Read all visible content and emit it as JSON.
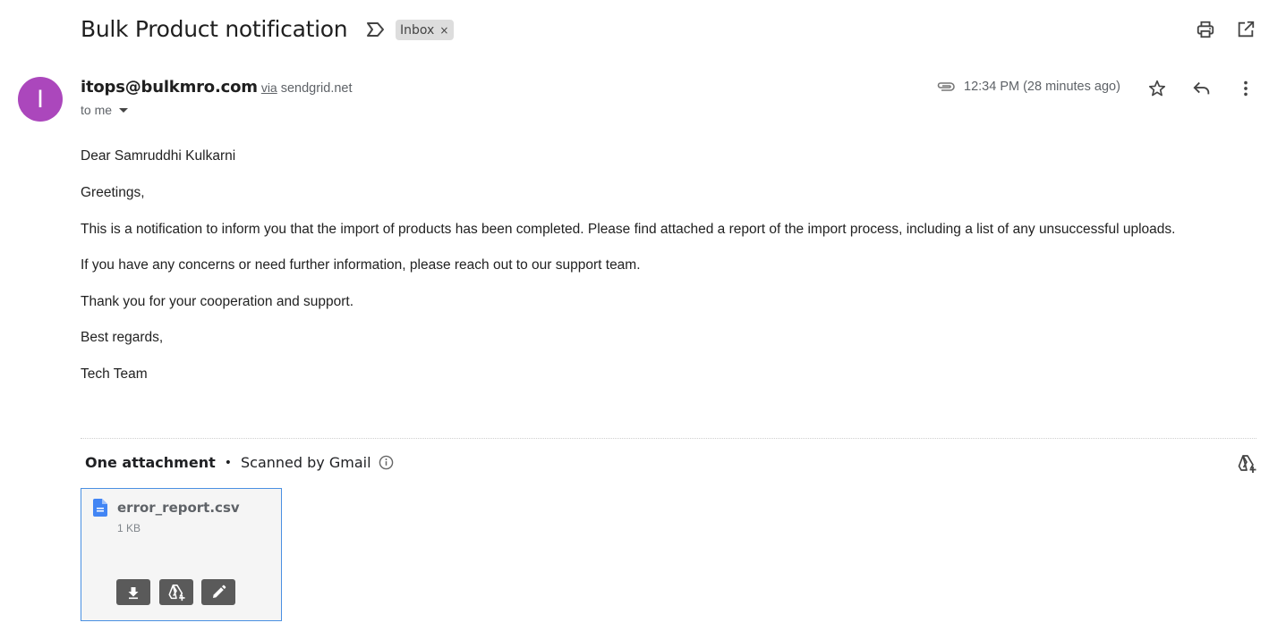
{
  "email": {
    "subject": "Bulk Product notification",
    "label_chip": "Inbox",
    "label_chip_close": "×",
    "sender_email": "itops@bulkmro.com",
    "via_word": "via",
    "via_domain": "sendgrid.net",
    "recipient": "to me",
    "avatar_letter": "I",
    "avatar_color": "#ab47bc",
    "timestamp": "12:34 PM (28 minutes ago)",
    "body": [
      "Dear Samruddhi Kulkarni",
      "Greetings,",
      "This is a notification to inform you that the import of products has been completed. Please find attached a report of the import process, including a list of any unsuccessful uploads.",
      "If you have any concerns or need further information, please reach out to our support team.",
      "Thank you for your cooperation and support.",
      "Best regards,",
      "Tech Team"
    ]
  },
  "attachments": {
    "count_label": "One attachment",
    "separator": "•",
    "scan_label": "Scanned by Gmail",
    "items": [
      {
        "file_name": "error_report.csv",
        "size": "1 KB",
        "icon": "doc-icon"
      }
    ]
  },
  "icons": {
    "header": [
      "important-marker-icon",
      "print-icon",
      "open-in-new-window-icon"
    ],
    "sender_row": [
      "attachment-clip-icon",
      "star-icon",
      "reply-icon",
      "more-vert-icon"
    ],
    "attachments": [
      "info-icon",
      "add-to-drive-icon",
      "download-icon",
      "edit-icon"
    ]
  },
  "colors": {
    "accent_blue": "#4a90e2",
    "doc_icon_blue": "#4285f4",
    "card_button": "#5a5a5a"
  }
}
